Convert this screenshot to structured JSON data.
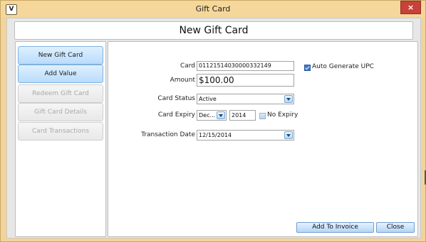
{
  "window": {
    "title": "Gift Card",
    "app_icon_glyph": "V",
    "close_glyph": "×"
  },
  "header": {
    "title": "New Gift Card"
  },
  "nav": {
    "items": [
      {
        "label": "New Gift Card",
        "state": "active"
      },
      {
        "label": "Add Value",
        "state": "active"
      },
      {
        "label": "Redeem Gift Card",
        "state": "disabled"
      },
      {
        "label": "Gift Card Details",
        "state": "disabled"
      },
      {
        "label": "Card Transactions",
        "state": "disabled"
      }
    ]
  },
  "form": {
    "card_label": "Card",
    "card_value": "01121514030000332149",
    "auto_upc_label": "Auto Generate UPC",
    "auto_upc_checked": true,
    "amount_label": "Amount",
    "amount_value": "$100.00",
    "status_label": "Card Status",
    "status_value": "Active",
    "expiry_label": "Card Expiry",
    "expiry_month": "Dec...",
    "expiry_year": "2014",
    "no_expiry_label": "No Expiry",
    "no_expiry_checked": false,
    "txn_date_label": "Transaction Date",
    "txn_date_value": "12/15/2014"
  },
  "actions": {
    "add_to_invoice": "Add To Invoice",
    "close": "Close"
  },
  "colors": {
    "titlebar": "#f5d79b",
    "close_button": "#c7423a",
    "nav_active": "#b8dcfb",
    "checkbox_checked": "#3a78c9"
  }
}
